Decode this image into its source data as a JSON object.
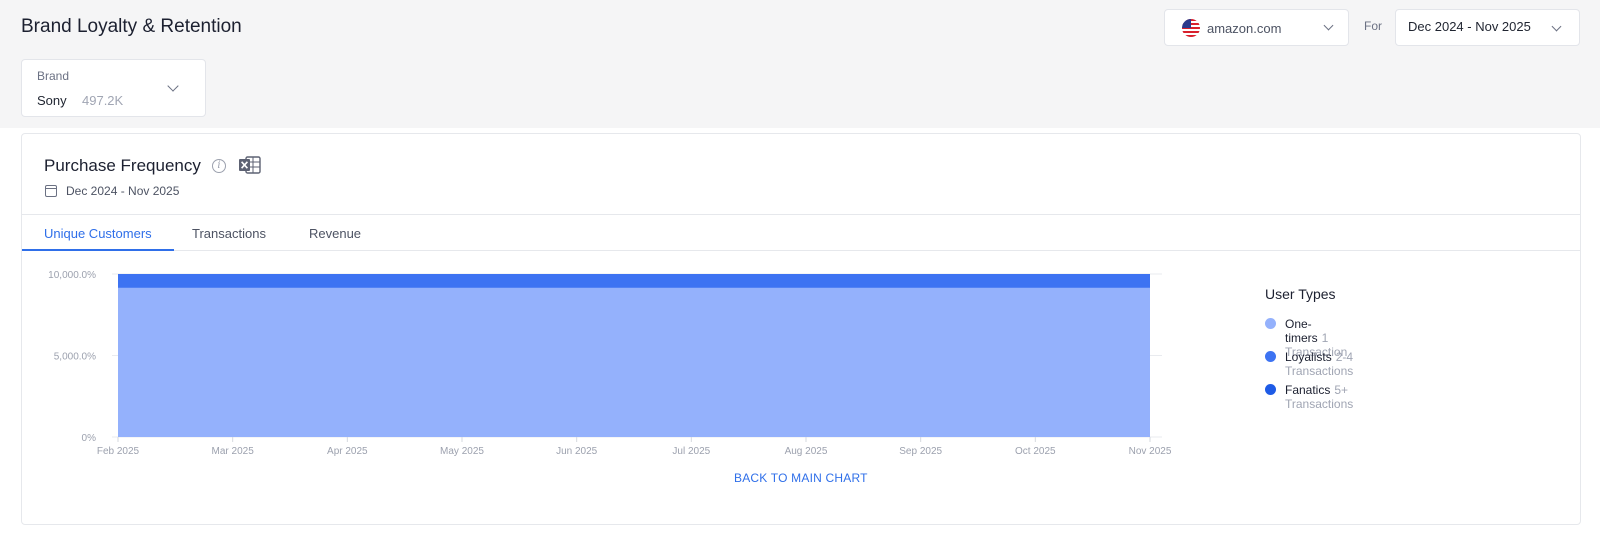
{
  "page": {
    "title": "Brand Loyalty & Retention"
  },
  "site_select": {
    "value": "amazon.com",
    "icon": "us-flag-icon"
  },
  "for_label": "For",
  "date_select": {
    "value": "Dec 2024 - Nov 2025"
  },
  "brand_select": {
    "caption": "Brand",
    "name": "Sony",
    "count": "497.2K"
  },
  "card": {
    "title": "Purchase Frequency",
    "date_range": "Dec 2024 - Nov 2025",
    "tabs": [
      {
        "label": "Unique Customers",
        "active": true
      },
      {
        "label": "Transactions",
        "active": false
      },
      {
        "label": "Revenue",
        "active": false
      }
    ],
    "back_link": "BACK TO MAIN CHART"
  },
  "chart_data": {
    "type": "area",
    "stacked": true,
    "x": [
      "Feb 2025",
      "Mar 2025",
      "Apr 2025",
      "May 2025",
      "Jun 2025",
      "Jul 2025",
      "Aug 2025",
      "Sep 2025",
      "Oct 2025",
      "Nov 2025"
    ],
    "y_ticks": [
      "10,000.0%",
      "5,000.0%",
      "0%"
    ],
    "ylim": [
      0,
      10000
    ],
    "series": [
      {
        "name": "One-timers",
        "color": "#94b1fc",
        "values": [
          9150,
          9150,
          9150,
          9150,
          9150,
          9150,
          9150,
          9150,
          9150,
          9150
        ]
      },
      {
        "name": "Loyalists",
        "color": "#3d73f2",
        "values": [
          850,
          850,
          850,
          850,
          850,
          850,
          850,
          850,
          850,
          850
        ]
      },
      {
        "name": "Fanatics",
        "color": "#1e5be6",
        "values": [
          0,
          0,
          0,
          0,
          0,
          0,
          0,
          0,
          0,
          0
        ]
      }
    ]
  },
  "legend": {
    "title": "User Types",
    "items": [
      {
        "name": "One-timers",
        "desc": "1 Transaction",
        "color": "#94b1fc"
      },
      {
        "name": "Loyalists",
        "desc": "2-4 Transactions",
        "color": "#3d73f2"
      },
      {
        "name": "Fanatics",
        "desc": "5+ Transactions",
        "color": "#1e5be6"
      }
    ]
  }
}
